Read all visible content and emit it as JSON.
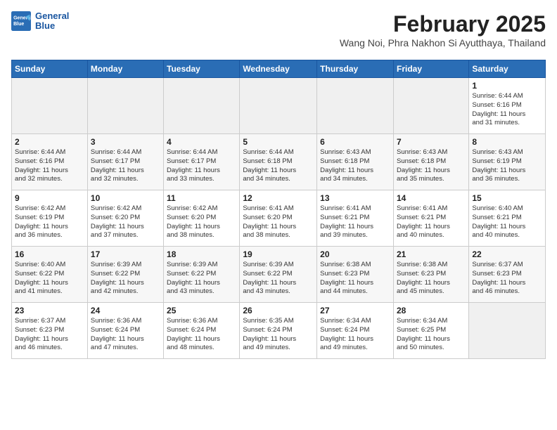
{
  "app": {
    "logo_line1": "General",
    "logo_line2": "Blue"
  },
  "calendar": {
    "title": "February 2025",
    "subtitle": "Wang Noi, Phra Nakhon Si Ayutthaya, Thailand",
    "headers": [
      "Sunday",
      "Monday",
      "Tuesday",
      "Wednesday",
      "Thursday",
      "Friday",
      "Saturday"
    ],
    "weeks": [
      [
        {
          "day": "",
          "info": ""
        },
        {
          "day": "",
          "info": ""
        },
        {
          "day": "",
          "info": ""
        },
        {
          "day": "",
          "info": ""
        },
        {
          "day": "",
          "info": ""
        },
        {
          "day": "",
          "info": ""
        },
        {
          "day": "1",
          "info": "Sunrise: 6:44 AM\nSunset: 6:16 PM\nDaylight: 11 hours\nand 31 minutes."
        }
      ],
      [
        {
          "day": "2",
          "info": "Sunrise: 6:44 AM\nSunset: 6:16 PM\nDaylight: 11 hours\nand 32 minutes."
        },
        {
          "day": "3",
          "info": "Sunrise: 6:44 AM\nSunset: 6:17 PM\nDaylight: 11 hours\nand 32 minutes."
        },
        {
          "day": "4",
          "info": "Sunrise: 6:44 AM\nSunset: 6:17 PM\nDaylight: 11 hours\nand 33 minutes."
        },
        {
          "day": "5",
          "info": "Sunrise: 6:44 AM\nSunset: 6:18 PM\nDaylight: 11 hours\nand 34 minutes."
        },
        {
          "day": "6",
          "info": "Sunrise: 6:43 AM\nSunset: 6:18 PM\nDaylight: 11 hours\nand 34 minutes."
        },
        {
          "day": "7",
          "info": "Sunrise: 6:43 AM\nSunset: 6:18 PM\nDaylight: 11 hours\nand 35 minutes."
        },
        {
          "day": "8",
          "info": "Sunrise: 6:43 AM\nSunset: 6:19 PM\nDaylight: 11 hours\nand 36 minutes."
        }
      ],
      [
        {
          "day": "9",
          "info": "Sunrise: 6:42 AM\nSunset: 6:19 PM\nDaylight: 11 hours\nand 36 minutes."
        },
        {
          "day": "10",
          "info": "Sunrise: 6:42 AM\nSunset: 6:20 PM\nDaylight: 11 hours\nand 37 minutes."
        },
        {
          "day": "11",
          "info": "Sunrise: 6:42 AM\nSunset: 6:20 PM\nDaylight: 11 hours\nand 38 minutes."
        },
        {
          "day": "12",
          "info": "Sunrise: 6:41 AM\nSunset: 6:20 PM\nDaylight: 11 hours\nand 38 minutes."
        },
        {
          "day": "13",
          "info": "Sunrise: 6:41 AM\nSunset: 6:21 PM\nDaylight: 11 hours\nand 39 minutes."
        },
        {
          "day": "14",
          "info": "Sunrise: 6:41 AM\nSunset: 6:21 PM\nDaylight: 11 hours\nand 40 minutes."
        },
        {
          "day": "15",
          "info": "Sunrise: 6:40 AM\nSunset: 6:21 PM\nDaylight: 11 hours\nand 40 minutes."
        }
      ],
      [
        {
          "day": "16",
          "info": "Sunrise: 6:40 AM\nSunset: 6:22 PM\nDaylight: 11 hours\nand 41 minutes."
        },
        {
          "day": "17",
          "info": "Sunrise: 6:39 AM\nSunset: 6:22 PM\nDaylight: 11 hours\nand 42 minutes."
        },
        {
          "day": "18",
          "info": "Sunrise: 6:39 AM\nSunset: 6:22 PM\nDaylight: 11 hours\nand 43 minutes."
        },
        {
          "day": "19",
          "info": "Sunrise: 6:39 AM\nSunset: 6:22 PM\nDaylight: 11 hours\nand 43 minutes."
        },
        {
          "day": "20",
          "info": "Sunrise: 6:38 AM\nSunset: 6:23 PM\nDaylight: 11 hours\nand 44 minutes."
        },
        {
          "day": "21",
          "info": "Sunrise: 6:38 AM\nSunset: 6:23 PM\nDaylight: 11 hours\nand 45 minutes."
        },
        {
          "day": "22",
          "info": "Sunrise: 6:37 AM\nSunset: 6:23 PM\nDaylight: 11 hours\nand 46 minutes."
        }
      ],
      [
        {
          "day": "23",
          "info": "Sunrise: 6:37 AM\nSunset: 6:23 PM\nDaylight: 11 hours\nand 46 minutes."
        },
        {
          "day": "24",
          "info": "Sunrise: 6:36 AM\nSunset: 6:24 PM\nDaylight: 11 hours\nand 47 minutes."
        },
        {
          "day": "25",
          "info": "Sunrise: 6:36 AM\nSunset: 6:24 PM\nDaylight: 11 hours\nand 48 minutes."
        },
        {
          "day": "26",
          "info": "Sunrise: 6:35 AM\nSunset: 6:24 PM\nDaylight: 11 hours\nand 49 minutes."
        },
        {
          "day": "27",
          "info": "Sunrise: 6:34 AM\nSunset: 6:24 PM\nDaylight: 11 hours\nand 49 minutes."
        },
        {
          "day": "28",
          "info": "Sunrise: 6:34 AM\nSunset: 6:25 PM\nDaylight: 11 hours\nand 50 minutes."
        },
        {
          "day": "",
          "info": ""
        }
      ]
    ]
  }
}
